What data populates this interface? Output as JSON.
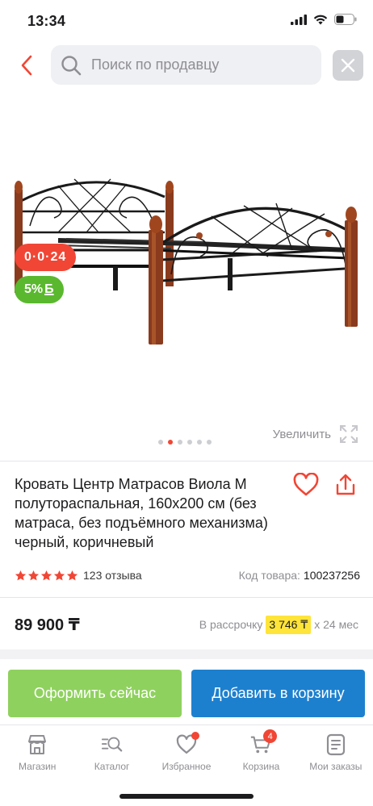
{
  "status_bar": {
    "time": "13:34"
  },
  "search": {
    "placeholder": "Поиск по продавцу"
  },
  "gallery": {
    "timer": "0·0·24",
    "bonus": {
      "value": "5%",
      "unit": "Б"
    },
    "zoom_label": "Увеличить",
    "total_images": 6,
    "active_image": 2
  },
  "product": {
    "title": "Кровать Центр Матрасов Виола М полутораспальная, 160x200 см (без матраса, без подъёмного механизма) черный, коричневый",
    "rating": 5,
    "reviews": "123 отзыва",
    "sku_label": "Код товара:",
    "sku_value": "100237256",
    "price": "89 900 ₸",
    "installment": {
      "prefix": "В рассрочку",
      "amount": "3 746 ₸",
      "suffix": "х 24 мес"
    }
  },
  "actions": {
    "order": "Оформить сейчас",
    "cart": "Добавить в корзину"
  },
  "tabbar": {
    "items": [
      {
        "label": "Магазин",
        "icon": "shop-icon"
      },
      {
        "label": "Каталог",
        "icon": "catalog-search-icon"
      },
      {
        "label": "Избранное",
        "icon": "heart-icon"
      },
      {
        "label": "Корзина",
        "icon": "cart-icon"
      },
      {
        "label": "Мои заказы",
        "icon": "orders-icon"
      }
    ],
    "cart_count": "4"
  },
  "colors": {
    "accent_red": "#f14635",
    "bonus_green": "#5ab82e",
    "order_green": "#8fd15e",
    "cart_blue": "#1d80cf",
    "installment_yellow": "#ffe43a"
  }
}
